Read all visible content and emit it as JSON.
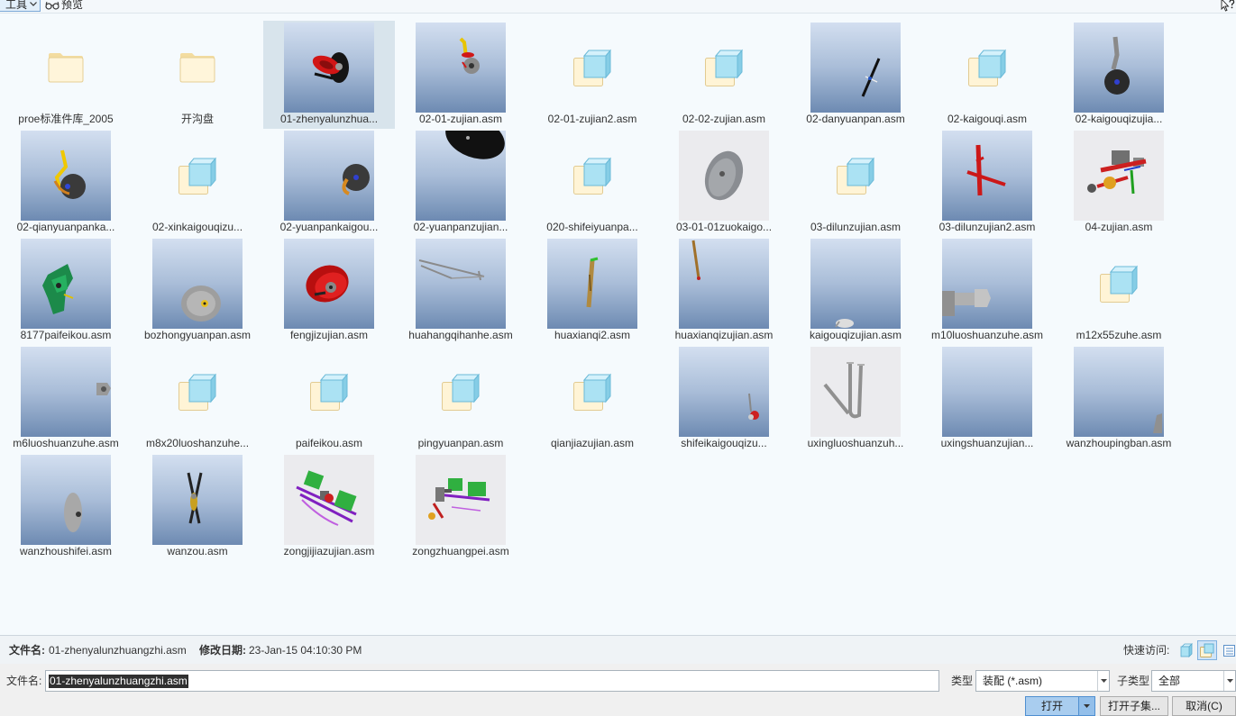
{
  "toolbar": {
    "tools_label": "工具",
    "preview_label": "预览"
  },
  "selected_index": 2,
  "files": [
    {
      "label": "proe标准件库_2005",
      "icon": "folder-icon"
    },
    {
      "label": "开沟盘",
      "icon": "folder-icon"
    },
    {
      "label": "01-zhenyalunzhua...",
      "icon": "red-disc-model-thumbnail"
    },
    {
      "label": "02-01-zujian.asm",
      "icon": "yellow-arm-disc-model-thumbnail"
    },
    {
      "label": "02-01-zujian2.asm",
      "icon": "assembly-file-icon"
    },
    {
      "label": "02-02-zujian.asm",
      "icon": "assembly-file-icon"
    },
    {
      "label": "02-danyuanpan.asm",
      "icon": "thin-blade-model-thumbnail"
    },
    {
      "label": "02-kaigouqi.asm",
      "icon": "assembly-file-icon"
    },
    {
      "label": "02-kaigouqizujia...",
      "icon": "arm-wheel-model-thumbnail"
    },
    {
      "label": "02-qianyuanpanka...",
      "icon": "bracket-disc-model-thumbnail"
    },
    {
      "label": "02-xinkaigouqizu...",
      "icon": "assembly-file-icon"
    },
    {
      "label": "02-yuanpankaigou...",
      "icon": "hook-disc-model-thumbnail"
    },
    {
      "label": "02-yuanpanzujian...",
      "icon": "large-black-disc-model-thumbnail"
    },
    {
      "label": "020-shifeiyuanpa...",
      "icon": "assembly-file-icon"
    },
    {
      "label": "03-01-01zuokaigo...",
      "icon": "gray-disc-model-thumbnail"
    },
    {
      "label": "03-dilunzujian.asm",
      "icon": "assembly-file-icon"
    },
    {
      "label": "03-dilunzujian2.asm",
      "icon": "red-frame-model-thumbnail"
    },
    {
      "label": "04-zujian.asm",
      "icon": "multicolor-assembly-model-thumbnail"
    },
    {
      "label": "8177paifeikou.asm",
      "icon": "green-part-model-thumbnail"
    },
    {
      "label": "bozhongyuanpan.asm",
      "icon": "seeding-disc-model-thumbnail"
    },
    {
      "label": "fengjizujian.asm",
      "icon": "red-fan-model-thumbnail"
    },
    {
      "label": "huahangqihanhe.asm",
      "icon": "linkage-model-thumbnail"
    },
    {
      "label": "huaxianqi2.asm",
      "icon": "marker-stick-model-thumbnail"
    },
    {
      "label": "huaxianqizujian.asm",
      "icon": "brown-stick-model-thumbnail"
    },
    {
      "label": "kaigouqizujian.asm",
      "icon": "small-part-model-thumbnail"
    },
    {
      "label": "m10luoshuanzuhe.asm",
      "icon": "bolt-model-thumbnail"
    },
    {
      "label": "m12x55zuhe.asm",
      "icon": "assembly-file-icon"
    },
    {
      "label": "m6luoshuanzuhe.asm",
      "icon": "nut-model-thumbnail"
    },
    {
      "label": "m8x20luoshanzuhe...",
      "icon": "assembly-file-icon"
    },
    {
      "label": "paifeikou.asm",
      "icon": "assembly-file-icon"
    },
    {
      "label": "pingyuanpan.asm",
      "icon": "assembly-file-icon"
    },
    {
      "label": "qianjiazujian.asm",
      "icon": "assembly-file-icon"
    },
    {
      "label": "shifeikaigouqizu...",
      "icon": "small-red-part-model-thumbnail"
    },
    {
      "label": "uxingluoshuanzuh...",
      "icon": "u-bolt-model-thumbnail"
    },
    {
      "label": "uxingshuanzujian...",
      "icon": "empty-model-thumbnail"
    },
    {
      "label": "wanzhoupingban.asm",
      "icon": "plate-edge-model-thumbnail"
    },
    {
      "label": "wanzhoushifei.asm",
      "icon": "side-disc-model-thumbnail"
    },
    {
      "label": "wanzou.asm",
      "icon": "crossed-blades-model-thumbnail"
    },
    {
      "label": "zongjijiazujian.asm",
      "icon": "frame-assembly-model-thumbnail"
    },
    {
      "label": "zongzhuangpei.asm",
      "icon": "full-assembly-model-thumbnail"
    }
  ],
  "info": {
    "name_label": "文件名:",
    "name_value": "01-zhenyalunzhuangzhi.asm",
    "date_label": "修改日期:",
    "date_value": "23-Jan-15 04:10:30 PM",
    "quick_access_label": "快速访问:"
  },
  "form": {
    "filename_label": "文件名:",
    "filename_value": "01-zhenyalunzhuangzhi.asm",
    "type_label": "类型",
    "type_value": "装配 (*.asm)",
    "subtype_label": "子类型",
    "subtype_value": "全部"
  },
  "buttons": {
    "open": "打开",
    "open_subset": "打开子集...",
    "cancel": "取消(C)"
  }
}
